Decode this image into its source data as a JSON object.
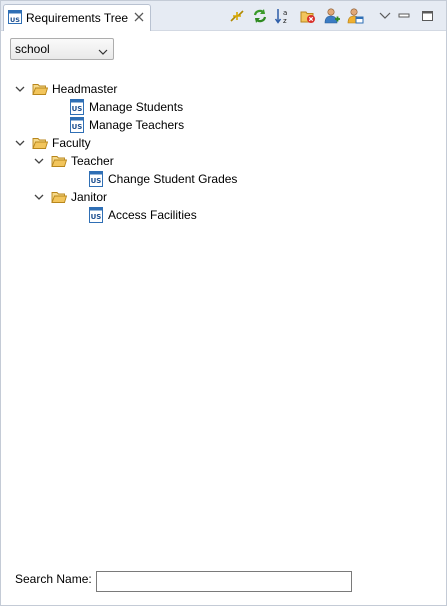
{
  "view": {
    "tab_title": "Requirements Tree",
    "tab_icon_text": "US"
  },
  "toolbar": {
    "buttons": [
      {
        "name": "collapse-all-icon"
      },
      {
        "name": "refresh-icon"
      },
      {
        "name": "sort-az-icon",
        "text": "a z"
      },
      {
        "name": "delete-requirement-icon"
      },
      {
        "name": "add-actor-icon"
      },
      {
        "name": "add-user-story-icon"
      },
      {
        "name": "view-menu-chevron-icon"
      },
      {
        "name": "minimize-icon"
      },
      {
        "name": "maximize-icon"
      }
    ]
  },
  "project_selector": {
    "selected": "school"
  },
  "tree": {
    "nodes": [
      {
        "label": "Headmaster",
        "type": "folder",
        "depth": 0,
        "expanded": true
      },
      {
        "label": "Manage Students",
        "type": "story",
        "depth": 1
      },
      {
        "label": "Manage Teachers",
        "type": "story",
        "depth": 1
      },
      {
        "label": "Faculty",
        "type": "folder",
        "depth": 0,
        "expanded": true
      },
      {
        "label": "Teacher",
        "type": "folder",
        "depth": 1,
        "expanded": true
      },
      {
        "label": "Change Student Grades",
        "type": "story",
        "depth": 2
      },
      {
        "label": "Janitor",
        "type": "folder",
        "depth": 1,
        "expanded": true
      },
      {
        "label": "Access Facilities",
        "type": "story",
        "depth": 2
      }
    ]
  },
  "search": {
    "label": "Search Name:",
    "value": ""
  },
  "colors": {
    "tab_bar": "#e6ebf3",
    "folder": "#f2c55c",
    "story_icon": "#2f6fb5"
  }
}
